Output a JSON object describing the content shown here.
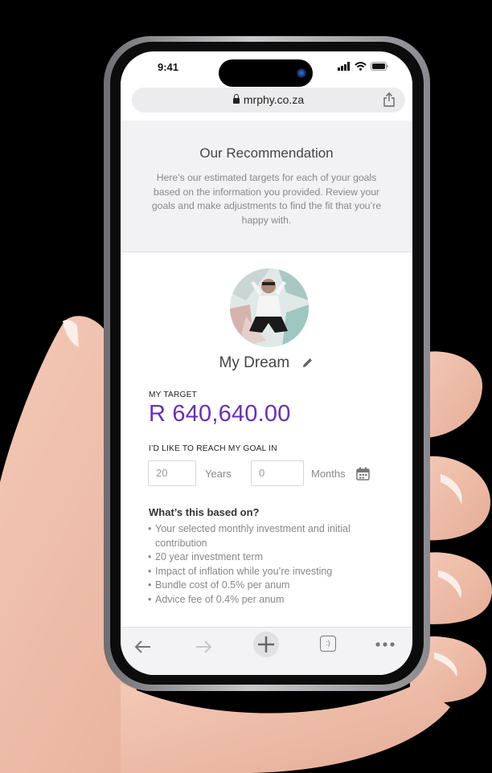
{
  "status_bar": {
    "time": "9:41"
  },
  "browser": {
    "url": "mrphy.co.za"
  },
  "recommendation": {
    "title": "Our Recommendation",
    "description": "Here’s our estimated targets for each of your goals based on the information you provided. Review your goals and make adjustments to find the fit that you’re happy with."
  },
  "goal": {
    "name": "My Dream",
    "target_label": "MY TARGET",
    "target_value": "R 640,640.00",
    "reach_label": "I’D LIKE TO REACH MY GOAL IN",
    "years_value": "20",
    "years_unit": "Years",
    "months_value": "0",
    "months_unit": "Months"
  },
  "based_on": {
    "title": "What’s this based on?",
    "items": [
      "Your selected monthly investment and initial contribution",
      "20 year investment term",
      "Impact of inflation while you’re investing",
      "Bundle cost of 0.5% per anum",
      "Advice fee of 0.4% per anum"
    ]
  },
  "toolbar": {
    "icons": [
      "back-arrow-icon",
      "forward-arrow-icon",
      "new-tab-plus-icon",
      "tabs-icon",
      "more-icon"
    ],
    "tabs_glyph": ":)"
  },
  "colors": {
    "accent": "#6a2fb6",
    "panel_bg": "#f2f2f4"
  }
}
